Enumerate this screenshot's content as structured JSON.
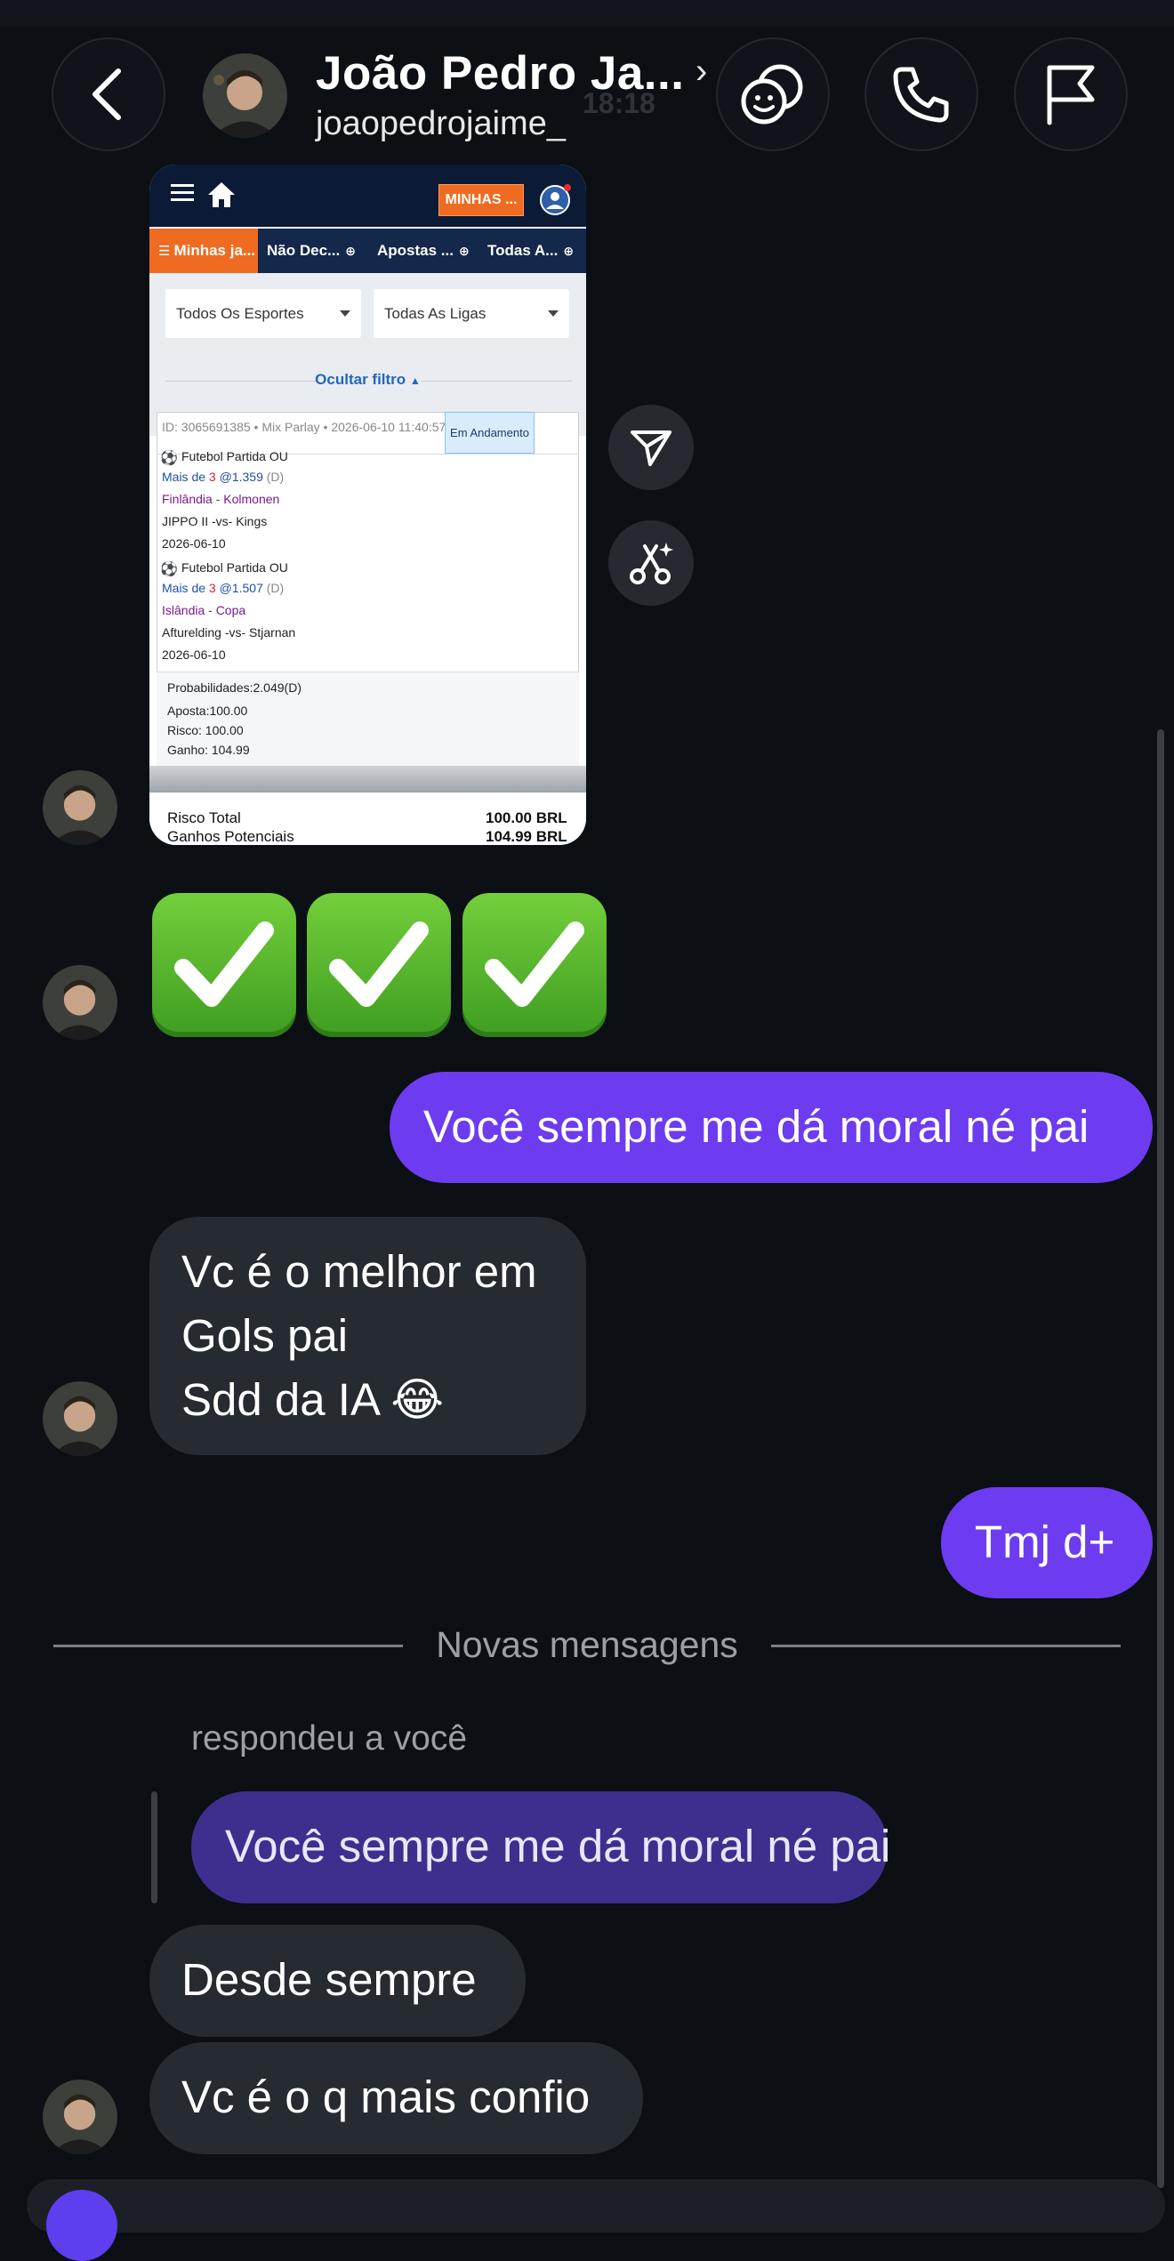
{
  "header": {
    "contact_name": "João Pedro Ja...",
    "username": "joaopedrojaime_",
    "ghost_time": "18:18",
    "back_icon": "chevron-left-icon",
    "chevron_icon": "chevron-right-icon",
    "actions": [
      "stickers-icon",
      "phone-icon",
      "flag-icon"
    ]
  },
  "screenshot": {
    "minhas_button": "MINHAS ...",
    "tabs": [
      "Minhas ja...",
      "Não Dec...",
      "Apostas ...",
      "Todas A..."
    ],
    "filter_sport": "Todos Os Esportes",
    "filter_league": "Todas As Ligas",
    "hide_filter": "Ocultar filtro",
    "bet_id": "ID: 3065691385 • Mix Parlay • 2026-06-10 11:40:57",
    "status": "Em Andamento",
    "legs": [
      {
        "market": "Futebol Partida OU",
        "pick_prefix": "Mais de",
        "pick_line": "3",
        "pick_odds": "@1.359",
        "pick_tag": "(D)",
        "league": "Finlândia - Kolmonen",
        "match": "JIPPO II -vs- Kings",
        "date": "2026-06-10"
      },
      {
        "market": "Futebol Partida OU",
        "pick_prefix": "Mais de",
        "pick_line": "3",
        "pick_odds": "@1.507",
        "pick_tag": "(D)",
        "league": "Islândia - Copa",
        "match": "Afturelding -vs- Stjarnan",
        "date": "2026-06-10"
      }
    ],
    "probabilities": "Probabilidades:2.049(D)",
    "stake": "Aposta:100.00",
    "risk": "Risco: 100.00",
    "gain": "Ganho: 104.99",
    "total_risk_label": "Risco Total",
    "total_risk_value": "100.00 BRL",
    "potential_label": "Ganhos Potenciais",
    "potential_value": "104.99 BRL"
  },
  "side_actions": [
    "send-icon",
    "cut-sparkle-icon"
  ],
  "messages": {
    "checks": [
      "✅",
      "✅",
      "✅"
    ],
    "out_1": "Você sempre me dá moral né pai",
    "in_1_line1": "Vc é o melhor em",
    "in_1_line2": "Gols pai",
    "in_1_line3": "Sdd da IA 😂",
    "out_2": "Tmj d+",
    "new_messages": "Novas mensagens",
    "replied_label": "respondeu a você",
    "quoted": "Você sempre me dá moral né pai",
    "in_2": "Desde sempre",
    "in_3": "Vc é o q mais confio"
  }
}
